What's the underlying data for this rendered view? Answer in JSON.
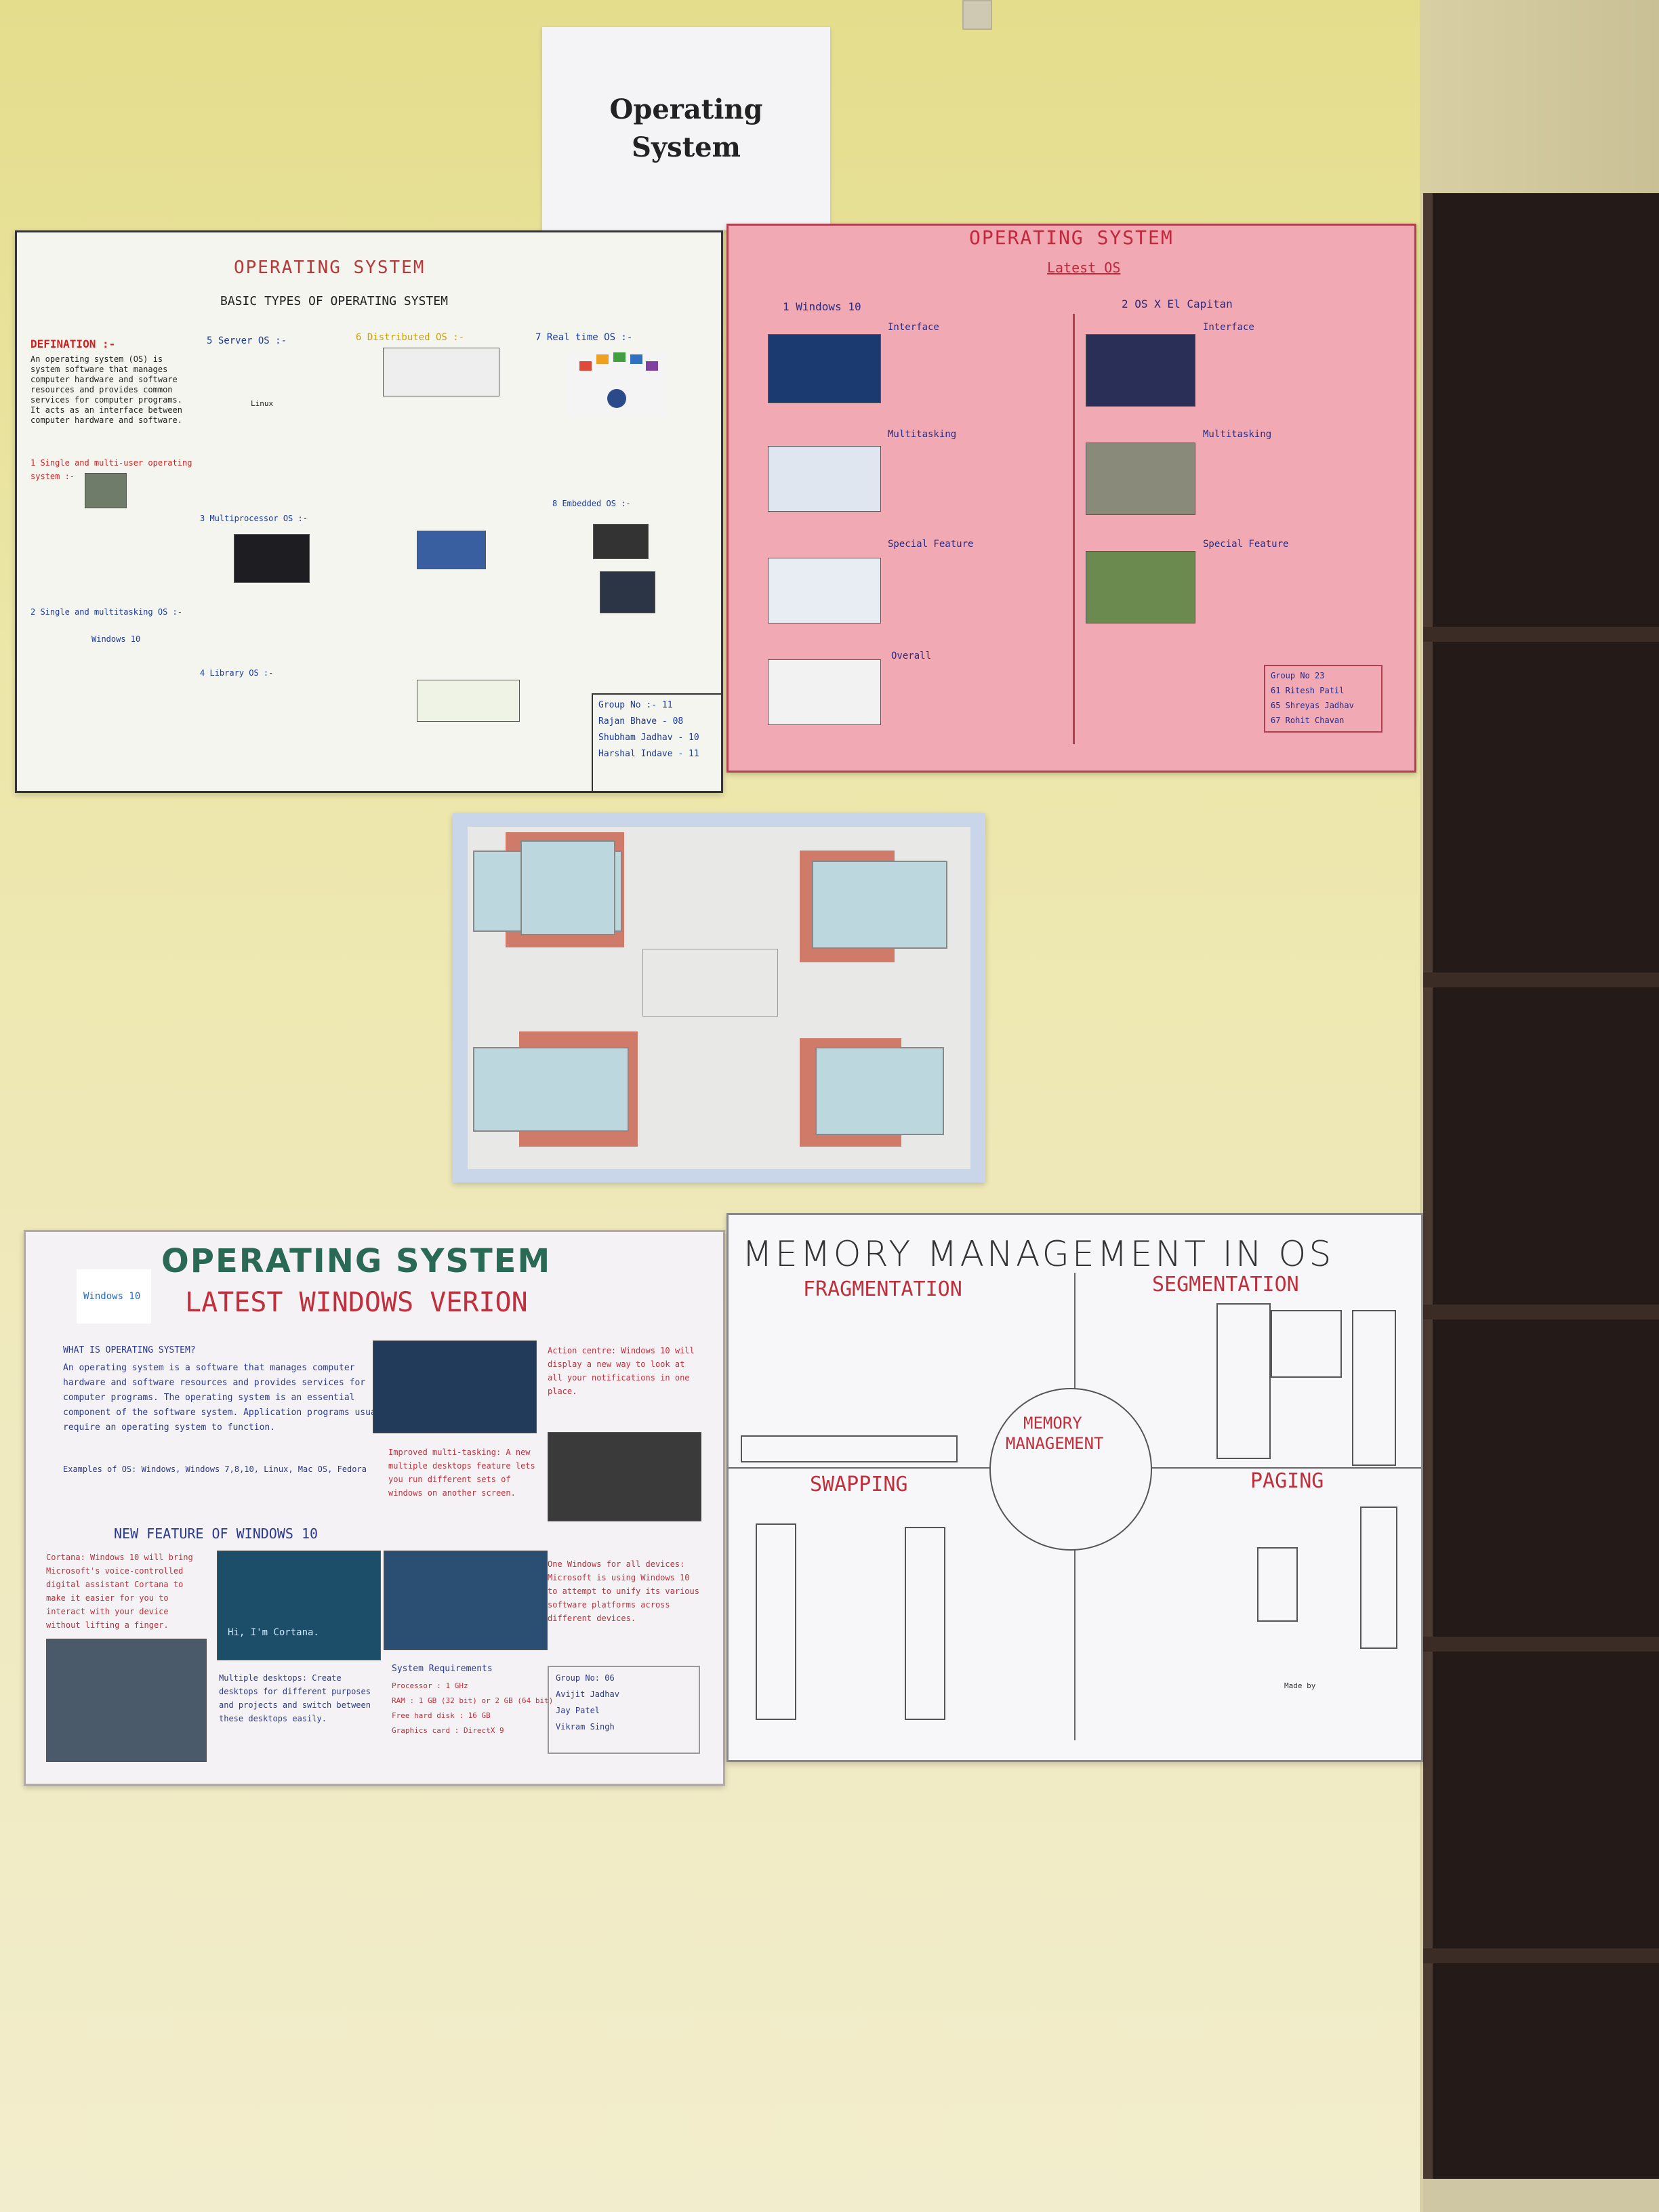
{
  "sign": {
    "line1": "Operating",
    "line2": "System"
  },
  "poster1": {
    "title": "OPERATING SYSTEM",
    "subtitle": "BASIC TYPES OF OPERATING SYSTEM",
    "definition_heading": "DEFINATION :-",
    "definition_text": "An operating system (OS) is system software that manages computer hardware and software resources and provides common services for computer programs. It acts as an interface between computer hardware and software.",
    "col2_heading": "5 Server OS :-",
    "col3_heading": "6 Distributed OS :-",
    "col4_heading": "7 Real time OS :-",
    "item1": "1 Single and multi-user operating system :-",
    "item2": "2 Single and multitasking OS :-",
    "item3": "3 Multiprocessor OS :-",
    "item4": "4 Library OS :-",
    "item8": "8 Embedded OS :-",
    "windows_label": "Windows 10",
    "linux_label": "Linux",
    "group": [
      "Group No :- 11",
      "Rajan Bhave - 08",
      "Shubham Jadhav - 10",
      "Harshal Indave - 11"
    ]
  },
  "poster2": {
    "title": "OPERATING SYSTEM",
    "subtitle": "Latest OS",
    "left_heading": "1 Windows 10",
    "right_heading": "2 OS X El Capitan",
    "rows": [
      "Interface",
      "Multitasking",
      "Special Feature",
      "Overall"
    ],
    "group": [
      "Group No 23",
      "61 Ritesh Patil",
      "65 Shreyas Jadhav",
      "67 Rohit Chavan"
    ]
  },
  "poster4": {
    "title": "OPERATING SYSTEM",
    "subtitle": "LATEST WINDOWS VERION",
    "what_heading": "WHAT IS OPERATING SYSTEM?",
    "what_text": "An operating system is a software that manages computer hardware and software resources and provides services for computer programs. The operating system is an essential component of the software system. Application programs usually require an operating system to function.",
    "examples": "Examples of OS: Windows, Windows 7,8,10, Linux, Mac OS, Fedora",
    "new_feature": "NEW FEATURE OF WINDOWS 10",
    "cortana": "Cortana: Windows 10 will bring Microsoft's voice-controlled digital assistant Cortana to make it easier for you to interact with your device without lifting a finger.",
    "cortana_caption": "Hi, I'm Cortana.",
    "windows_logo": "Windows 10",
    "action_center": "Action centre: Windows 10 will display a new way to look at all your notifications in one place.",
    "multitask": "Improved multi-tasking: A new multiple desktops feature lets you run different sets of windows on another screen.",
    "one_windows": "One Windows for all devices: Microsoft is using Windows 10 to attempt to unify its various software platforms across different devices.",
    "multiple_desktops": "Multiple desktops: Create desktops for different purposes and projects and switch between these desktops easily.",
    "requirements_heading": "System Requirements",
    "requirements": [
      "Processor : 1 GHz",
      "RAM : 1 GB (32 bit) or 2 GB (64 bit)",
      "Free hard disk : 16 GB",
      "Graphics card : DirectX 9"
    ],
    "group": [
      "Group No: 06",
      "Avijit Jadhav",
      "Jay Patel",
      "Vikram Singh"
    ]
  },
  "poster5": {
    "title": "MEMORY MANAGEMENT IN OS",
    "fragmentation": "FRAGMENTATION",
    "segmentation": "SEGMENTATION",
    "swapping": "SWAPPING",
    "paging": "PAGING",
    "center": [
      "MEMORY",
      "MANAGEMENT"
    ],
    "made_by": "Made by"
  }
}
